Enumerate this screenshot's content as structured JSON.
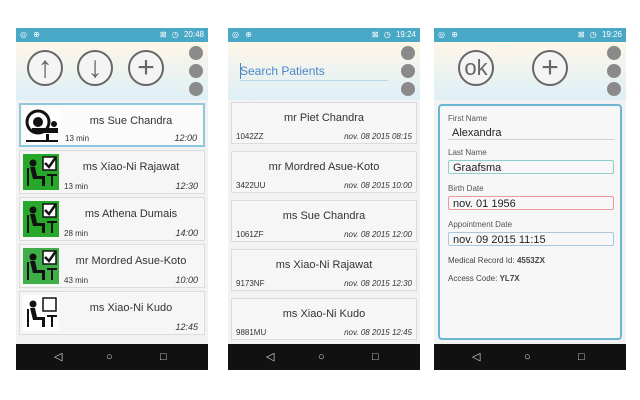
{
  "screens": [
    {
      "status": {
        "time": "20:48"
      },
      "toolbar": {
        "up_label": "↑",
        "down_label": "↓",
        "add_label": "+"
      },
      "appointments": [
        {
          "name": "ms Sue Chandra",
          "duration": "13 min",
          "time": "12:00",
          "icon": "scanner-icon",
          "selected": true
        },
        {
          "name": "ms Xiao-Ni Rajawat",
          "duration": "13 min",
          "time": "12:30",
          "icon": "seated-patient-checked-icon"
        },
        {
          "name": "ms Athena Dumais",
          "duration": "28 min",
          "time": "14:00",
          "icon": "seated-patient-checked-icon"
        },
        {
          "name": "mr Mordred Asue-Koto",
          "duration": "43 min",
          "time": "10:00",
          "icon": "seated-patient-checked-icon"
        },
        {
          "name": "ms Xiao-Ni Kudo",
          "duration": "",
          "time": "12:45",
          "icon": "seated-patient-waiting-icon"
        }
      ]
    },
    {
      "status": {
        "time": "19:24"
      },
      "search": {
        "placeholder": "Search Patients"
      },
      "patients": [
        {
          "name": "mr Piet Chandra",
          "code": "1042ZZ",
          "date": "nov. 08 2015 08:15"
        },
        {
          "name": "mr Mordred Asue-Koto",
          "code": "3422UU",
          "date": "nov. 08 2015 10:00"
        },
        {
          "name": "ms Sue Chandra",
          "code": "1061ZF",
          "date": "nov. 08 2015 12:00"
        },
        {
          "name": "ms Xiao-Ni Rajawat",
          "code": "9173NF",
          "date": "nov. 08 2015 12:30"
        },
        {
          "name": "ms Xiao-Ni Kudo",
          "code": "9881MU",
          "date": "nov. 08 2015 12:45"
        }
      ]
    },
    {
      "status": {
        "time": "19:26"
      },
      "toolbar": {
        "ok_label": "ok",
        "add_label": "+"
      },
      "form": {
        "first_name_label": "First Name",
        "first_name": "Alexandra",
        "last_name_label": "Last Name",
        "last_name": "Graafsma",
        "birth_date_label": "Birth Date",
        "birth_date": "nov. 01 1956",
        "appointment_date_label": "Appointment Date",
        "appointment_date": "nov. 09 2015 11:15",
        "medical_record_label": "Medical Record Id:",
        "medical_record_id": "4553ZX",
        "access_code_label": "Access Code:",
        "access_code": "YL7X"
      }
    }
  ],
  "nav": {
    "back": "◁",
    "home": "○",
    "recent": "□"
  },
  "status_icons": {
    "left": "◎ ⊕",
    "signal": "⊠",
    "alarm": "◷"
  },
  "colors": {
    "status_bar": "#4aa8c7",
    "accent": "#4a86c7",
    "selected_border": "#8fc6e0",
    "check_green": "#27a82a"
  }
}
